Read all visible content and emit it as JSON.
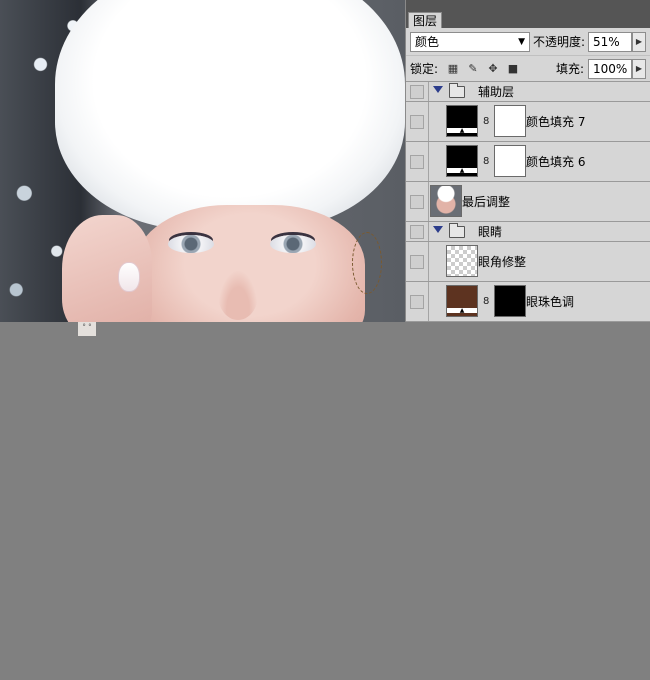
{
  "panel": {
    "tab_label": "图层",
    "blend_mode": "颜色",
    "opacity_label": "不透明度:",
    "opacity_value": "51%",
    "lock_label": "锁定:",
    "fill_label": "填充:",
    "fill_value": "100%"
  },
  "layers": [
    {
      "type": "group",
      "name": "辅助层"
    },
    {
      "type": "fill",
      "name": "颜色填充 7",
      "thumb_color": "#000000"
    },
    {
      "type": "fill",
      "name": "颜色填充 6",
      "thumb_color": "#000000"
    },
    {
      "type": "pixel",
      "name": "最后调整"
    },
    {
      "type": "group",
      "name": "眼睛"
    },
    {
      "type": "pixel",
      "name": "眼角修整"
    },
    {
      "type": "fill",
      "name": "眼珠色调",
      "thumb_color": "#5d3320"
    }
  ],
  "colors": {
    "canvas_background": "#808080",
    "panel_background": "#d6d6d6",
    "group_triangle": "#2c3d8c"
  }
}
